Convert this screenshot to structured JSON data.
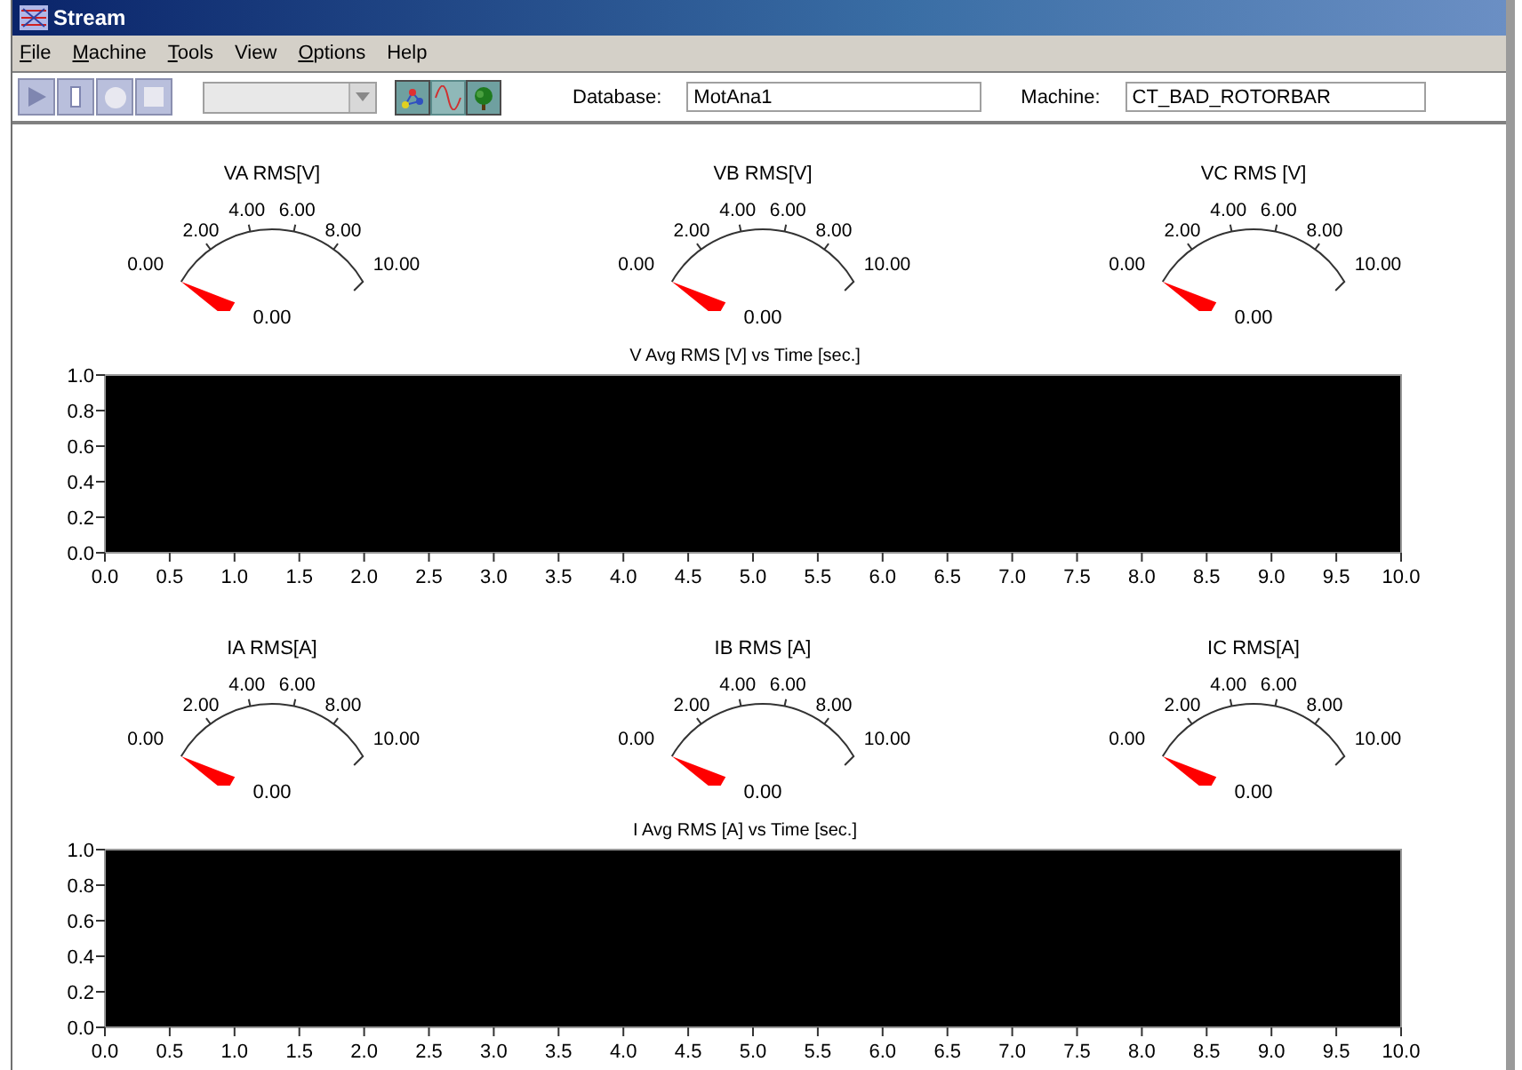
{
  "window": {
    "title": "Stream"
  },
  "menu": [
    {
      "label": "File",
      "underline_first": true
    },
    {
      "label": "Machine",
      "underline_first": true
    },
    {
      "label": "Tools",
      "underline_first": true
    },
    {
      "label": "View",
      "underline_first": false
    },
    {
      "label": "Options",
      "underline_first": true
    },
    {
      "label": "Help",
      "underline_first": false
    }
  ],
  "toolbar": {
    "transport": [
      {
        "kind": "play"
      },
      {
        "kind": "pause"
      },
      {
        "kind": "record"
      },
      {
        "kind": "stop"
      }
    ],
    "views": [
      {
        "kind": "nodes",
        "selected": false
      },
      {
        "kind": "wave",
        "selected": true
      },
      {
        "kind": "tree",
        "selected": false
      }
    ],
    "database": {
      "label": "Database:",
      "value": "MotAna1"
    },
    "machine": {
      "label": "Machine:",
      "value": "CT_BAD_ROTORBAR"
    }
  },
  "sections": [
    {
      "gauges": [
        {
          "title": "VA RMS[V]",
          "ticks": [
            "0.00",
            "2.00",
            "4.00",
            "6.00",
            "8.00",
            "10.00"
          ],
          "reading": "0.00"
        },
        {
          "title": "VB RMS[V]",
          "ticks": [
            "0.00",
            "2.00",
            "4.00",
            "6.00",
            "8.00",
            "10.00"
          ],
          "reading": "0.00"
        },
        {
          "title": "VC RMS [V]",
          "ticks": [
            "0.00",
            "2.00",
            "4.00",
            "6.00",
            "8.00",
            "10.00"
          ],
          "reading": "0.00"
        }
      ],
      "chart_data": {
        "type": "line",
        "title": "V Avg RMS [V] vs Time [sec.]",
        "xlim": [
          0,
          10
        ],
        "ylim": [
          0,
          1
        ],
        "xticks": [
          {
            "value": 0,
            "label": "0.0"
          },
          {
            "value": 0.5,
            "label": "0.5"
          },
          {
            "value": 1,
            "label": "1.0"
          },
          {
            "value": 1.5,
            "label": "1.5"
          },
          {
            "value": 2,
            "label": "2.0"
          },
          {
            "value": 2.5,
            "label": "2.5"
          },
          {
            "value": 3,
            "label": "3.0"
          },
          {
            "value": 3.5,
            "label": "3.5"
          },
          {
            "value": 4,
            "label": "4.0"
          },
          {
            "value": 4.5,
            "label": "4.5"
          },
          {
            "value": 5,
            "label": "5.0"
          },
          {
            "value": 5.5,
            "label": "5.5"
          },
          {
            "value": 6,
            "label": "6.0"
          },
          {
            "value": 6.5,
            "label": "6.5"
          },
          {
            "value": 7,
            "label": "7.0"
          },
          {
            "value": 7.5,
            "label": "7.5"
          },
          {
            "value": 8,
            "label": "8.0"
          },
          {
            "value": 8.5,
            "label": "8.5"
          },
          {
            "value": 9,
            "label": "9.0"
          },
          {
            "value": 9.5,
            "label": "9.5"
          },
          {
            "value": 10,
            "label": "10.0"
          }
        ],
        "yticks": [
          {
            "value": 0,
            "label": "0.0"
          },
          {
            "value": 0.2,
            "label": "0.2"
          },
          {
            "value": 0.4,
            "label": "0.4"
          },
          {
            "value": 0.6,
            "label": "0.6"
          },
          {
            "value": 0.8,
            "label": "0.8"
          },
          {
            "value": 1,
            "label": "1.0"
          }
        ]
      }
    },
    {
      "gauges": [
        {
          "title": "IA RMS[A]",
          "ticks": [
            "0.00",
            "2.00",
            "4.00",
            "6.00",
            "8.00",
            "10.00"
          ],
          "reading": "0.00"
        },
        {
          "title": "IB RMS [A]",
          "ticks": [
            "0.00",
            "2.00",
            "4.00",
            "6.00",
            "8.00",
            "10.00"
          ],
          "reading": "0.00"
        },
        {
          "title": "IC RMS[A]",
          "ticks": [
            "0.00",
            "2.00",
            "4.00",
            "6.00",
            "8.00",
            "10.00"
          ],
          "reading": "0.00"
        }
      ],
      "chart_data": {
        "type": "line",
        "title": "I Avg RMS [A] vs Time [sec.]",
        "xlim": [
          0,
          10
        ],
        "ylim": [
          0,
          1
        ],
        "xticks": [
          {
            "value": 0,
            "label": "0.0"
          },
          {
            "value": 0.5,
            "label": "0.5"
          },
          {
            "value": 1,
            "label": "1.0"
          },
          {
            "value": 1.5,
            "label": "1.5"
          },
          {
            "value": 2,
            "label": "2.0"
          },
          {
            "value": 2.5,
            "label": "2.5"
          },
          {
            "value": 3,
            "label": "3.0"
          },
          {
            "value": 3.5,
            "label": "3.5"
          },
          {
            "value": 4,
            "label": "4.0"
          },
          {
            "value": 4.5,
            "label": "4.5"
          },
          {
            "value": 5,
            "label": "5.0"
          },
          {
            "value": 5.5,
            "label": "5.5"
          },
          {
            "value": 6,
            "label": "6.0"
          },
          {
            "value": 6.5,
            "label": "6.5"
          },
          {
            "value": 7,
            "label": "7.0"
          },
          {
            "value": 7.5,
            "label": "7.5"
          },
          {
            "value": 8,
            "label": "8.0"
          },
          {
            "value": 8.5,
            "label": "8.5"
          },
          {
            "value": 9,
            "label": "9.0"
          },
          {
            "value": 9.5,
            "label": "9.5"
          },
          {
            "value": 10,
            "label": "10.0"
          }
        ],
        "yticks": [
          {
            "value": 0,
            "label": "0.0"
          },
          {
            "value": 0.2,
            "label": "0.2"
          },
          {
            "value": 0.4,
            "label": "0.4"
          },
          {
            "value": 0.6,
            "label": "0.6"
          },
          {
            "value": 0.8,
            "label": "0.8"
          },
          {
            "value": 1,
            "label": "1.0"
          }
        ]
      }
    }
  ]
}
